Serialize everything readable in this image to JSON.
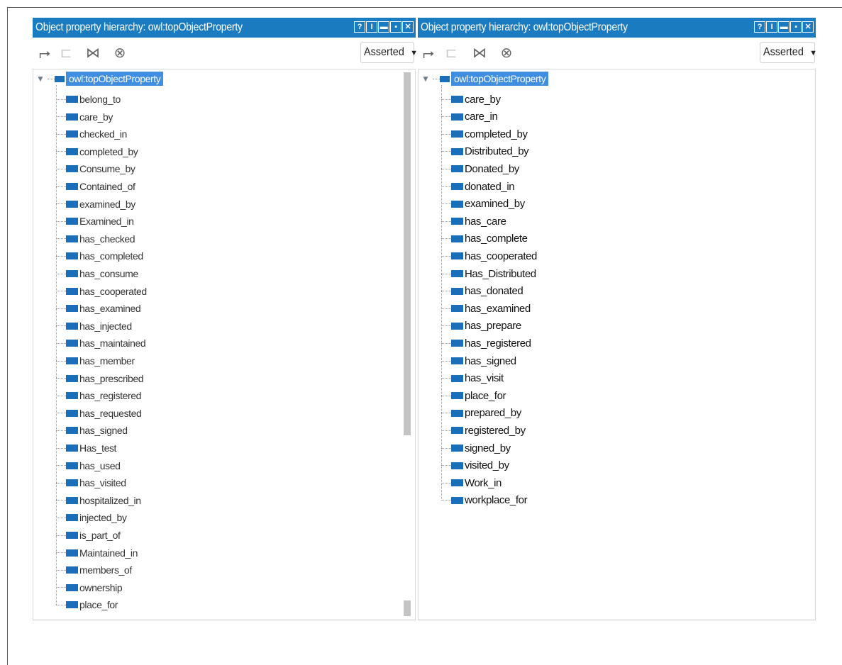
{
  "left_panel": {
    "title": "Object property hierarchy: owl:topObjectProperty",
    "win_buttons": [
      "?",
      "I",
      "▬",
      "▪",
      "✕"
    ],
    "mode": "Asserted",
    "root": "owl:topObjectProperty",
    "items": [
      "belong_to",
      "care_by",
      "checked_in",
      "completed_by",
      "Consume_by",
      "Contained_of",
      "examined_by",
      "Examined_in",
      "has_checked",
      "has_completed",
      "has_consume",
      "has_cooperated",
      "has_examined",
      "has_injected",
      "has_maintained",
      "has_member",
      "has_prescribed",
      "has_registered",
      "has_requested",
      "has_signed",
      "Has_test",
      "has_used",
      "has_visited",
      "hospitalized_in",
      "injected_by",
      "is_part_of",
      "Maintained_in",
      "members_of",
      "ownership",
      "place_for"
    ]
  },
  "right_panel": {
    "title": "Object property hierarchy: owl:topObjectProperty",
    "win_buttons": [
      "?",
      "I",
      "▬",
      "▪",
      "✕"
    ],
    "mode": "Asserted",
    "root": "owl:topObjectProperty",
    "items": [
      "care_by",
      "care_in",
      "completed_by",
      "Distributed_by",
      "Donated_by",
      "donated_in",
      "examined_by",
      "has_care",
      "has_complete",
      "has_cooperated",
      "Has_Distributed",
      "has_donated",
      "has_examined",
      "has_prepare",
      "has_registered",
      "has_signed",
      "has_visit",
      "place_for",
      "prepared_by",
      "registered_by",
      "signed_by",
      "visited_by",
      "Work_in",
      "workplace_for"
    ]
  },
  "icons": [
    "add-subproperty-icon",
    "add-sibling-icon",
    "delete-property-icon",
    "search-icon"
  ],
  "colors": {
    "titlebar": "#1b7bc0",
    "selection": "#3f8ee0",
    "property": "#1a6fb8"
  }
}
